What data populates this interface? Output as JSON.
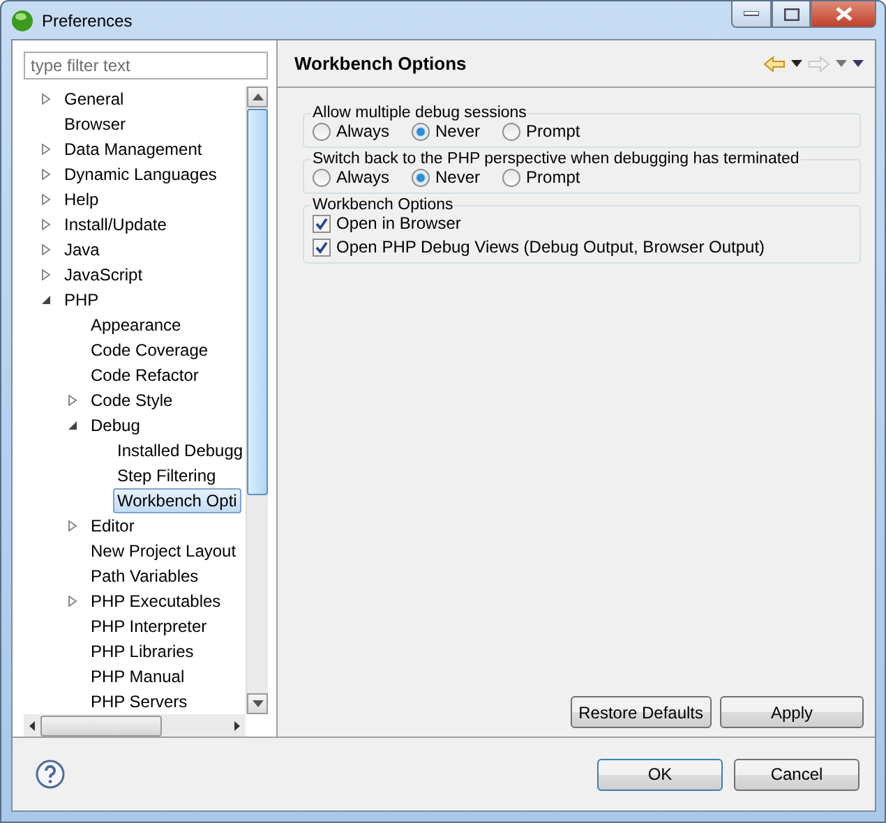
{
  "window": {
    "title": "Preferences"
  },
  "filter": {
    "placeholder": "type filter text"
  },
  "tree": [
    {
      "label": "General",
      "kind": "branch",
      "expanded": false,
      "selected": false
    },
    {
      "label": "Browser",
      "kind": "leaf",
      "selected": false
    },
    {
      "label": "Data Management",
      "kind": "branch",
      "expanded": false,
      "selected": false
    },
    {
      "label": "Dynamic Languages",
      "kind": "branch",
      "expanded": false,
      "selected": false
    },
    {
      "label": "Help",
      "kind": "branch",
      "expanded": false,
      "selected": false
    },
    {
      "label": "Install/Update",
      "kind": "branch",
      "expanded": false,
      "selected": false
    },
    {
      "label": "Java",
      "kind": "branch",
      "expanded": false,
      "selected": false
    },
    {
      "label": "JavaScript",
      "kind": "branch",
      "expanded": false,
      "selected": false
    },
    {
      "label": "PHP",
      "kind": "branch",
      "expanded": true,
      "selected": false,
      "children": [
        {
          "label": "Appearance",
          "kind": "leaf",
          "selected": false
        },
        {
          "label": "Code Coverage",
          "kind": "leaf",
          "selected": false
        },
        {
          "label": "Code Refactor",
          "kind": "leaf",
          "selected": false
        },
        {
          "label": "Code Style",
          "kind": "branch",
          "expanded": false,
          "selected": false
        },
        {
          "label": "Debug",
          "kind": "branch",
          "expanded": true,
          "selected": false,
          "children": [
            {
              "label": "Installed Debugg",
              "kind": "leaf",
              "selected": false
            },
            {
              "label": "Step Filtering",
              "kind": "leaf",
              "selected": false
            },
            {
              "label": "Workbench Opti",
              "kind": "leaf",
              "selected": true
            }
          ]
        },
        {
          "label": "Editor",
          "kind": "branch",
          "expanded": false,
          "selected": false
        },
        {
          "label": "New Project Layout",
          "kind": "leaf",
          "selected": false
        },
        {
          "label": "Path Variables",
          "kind": "leaf",
          "selected": false
        },
        {
          "label": "PHP Executables",
          "kind": "branch",
          "expanded": false,
          "selected": false
        },
        {
          "label": "PHP Interpreter",
          "kind": "leaf",
          "selected": false
        },
        {
          "label": "PHP Libraries",
          "kind": "leaf",
          "selected": false
        },
        {
          "label": "PHP Manual",
          "kind": "leaf",
          "selected": false
        },
        {
          "label": "PHP Servers",
          "kind": "leaf",
          "selected": false
        }
      ]
    }
  ],
  "page": {
    "title": "Workbench Options",
    "groups": [
      {
        "title": "Allow multiple debug sessions",
        "kind": "radio",
        "options": [
          {
            "label": "Always",
            "selected": false
          },
          {
            "label": "Never",
            "selected": true
          },
          {
            "label": "Prompt",
            "selected": false
          }
        ]
      },
      {
        "title": "Switch back to the PHP perspective when debugging has terminated",
        "kind": "radio",
        "options": [
          {
            "label": "Always",
            "selected": false
          },
          {
            "label": "Never",
            "selected": true
          },
          {
            "label": "Prompt",
            "selected": false
          }
        ]
      },
      {
        "title": "Workbench Options",
        "kind": "checkbox",
        "options": [
          {
            "label": "Open in Browser",
            "checked": true
          },
          {
            "label": "Open PHP Debug Views (Debug Output, Browser Output)",
            "checked": true
          }
        ]
      }
    ],
    "buttons": [
      "Restore Defaults",
      "Apply"
    ]
  },
  "footer": {
    "buttons": [
      {
        "label": "OK",
        "default": true
      },
      {
        "label": "Cancel",
        "default": false
      }
    ]
  }
}
